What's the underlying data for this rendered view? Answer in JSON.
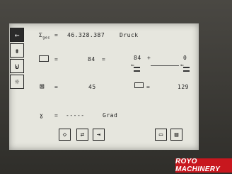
{
  "counter": {
    "symbol": "Σ",
    "subscript": "ges",
    "eq": "=",
    "value": "46.328.387",
    "unit": "Druck"
  },
  "row_sheet": {
    "eq": "=",
    "value": "84",
    "eq2": "=",
    "target_value": "84",
    "plus": "+",
    "offset_value": "0"
  },
  "row_delivery": {
    "eq": "=",
    "value": "45",
    "eq2": "=",
    "value2": "129"
  },
  "row_angle": {
    "symbol": "ɣ",
    "eq": "=",
    "value": "-----",
    "unit": "Grad"
  },
  "side_buttons": [
    {
      "icon": "arrow-left-icon",
      "active": true
    },
    {
      "icon": "feeder-icon",
      "active": false
    },
    {
      "icon": "roller-icon",
      "active": false
    },
    {
      "icon": "gear-icon",
      "active": false
    }
  ],
  "footer": {
    "logo": "ROYO MACHINERY"
  }
}
